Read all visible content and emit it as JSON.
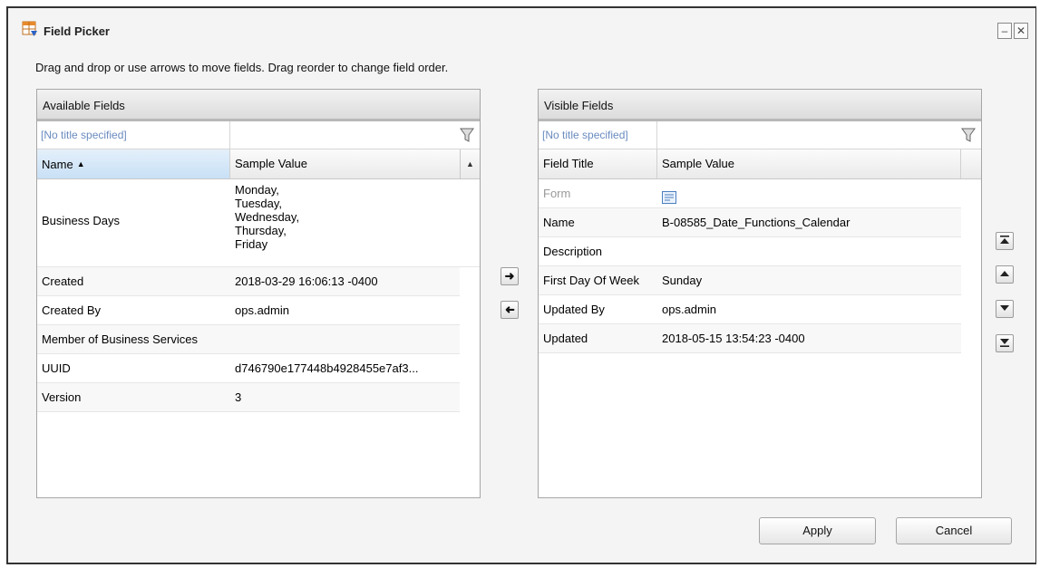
{
  "window": {
    "title": "Field Picker",
    "instruction": "Drag and drop or use arrows to move fields. Drag reorder to change field order."
  },
  "available": {
    "header": "Available Fields",
    "filter_placeholder": "[No title specified]",
    "columns": [
      "Name",
      "Sample Value"
    ],
    "sort": "ascending",
    "rows": [
      {
        "name": "Business Days",
        "value_lines": [
          "Monday,",
          "Tuesday,",
          "Wednesday,",
          "Thursday,",
          "Friday"
        ]
      },
      {
        "name": "Created",
        "value": "2018-03-29 16:06:13 -0400"
      },
      {
        "name": "Created By",
        "value": "ops.admin"
      },
      {
        "name": "Member of Business Services",
        "value": ""
      },
      {
        "name": "UUID",
        "value": "d746790e177448b4928455e7af3..."
      },
      {
        "name": "Version",
        "value": "3"
      }
    ]
  },
  "visible": {
    "header": "Visible Fields",
    "filter_placeholder": "[No title specified]",
    "columns": [
      "Field Title",
      "Sample Value"
    ],
    "rows": [
      {
        "name": "Form",
        "value": "",
        "icon": "form-icon",
        "disabled": true
      },
      {
        "name": "Name",
        "value": "B-08585_Date_Functions_Calendar"
      },
      {
        "name": "Description",
        "value": ""
      },
      {
        "name": "First Day Of Week",
        "value": "Sunday"
      },
      {
        "name": "Updated By",
        "value": "ops.admin"
      },
      {
        "name": "Updated",
        "value": "2018-05-15 13:54:23 -0400"
      }
    ]
  },
  "controls": {
    "move_right_icon": "arrow-right-icon",
    "move_left_icon": "arrow-left-icon",
    "move_top_icon": "move-top-icon",
    "move_up_icon": "move-up-icon",
    "move_down_icon": "move-down-icon",
    "move_bottom_icon": "move-bottom-icon"
  },
  "buttons": {
    "apply": "Apply",
    "cancel": "Cancel"
  },
  "colors": {
    "filter_text": "#6a8bbf",
    "sorted_header": "#c8e0f5"
  }
}
